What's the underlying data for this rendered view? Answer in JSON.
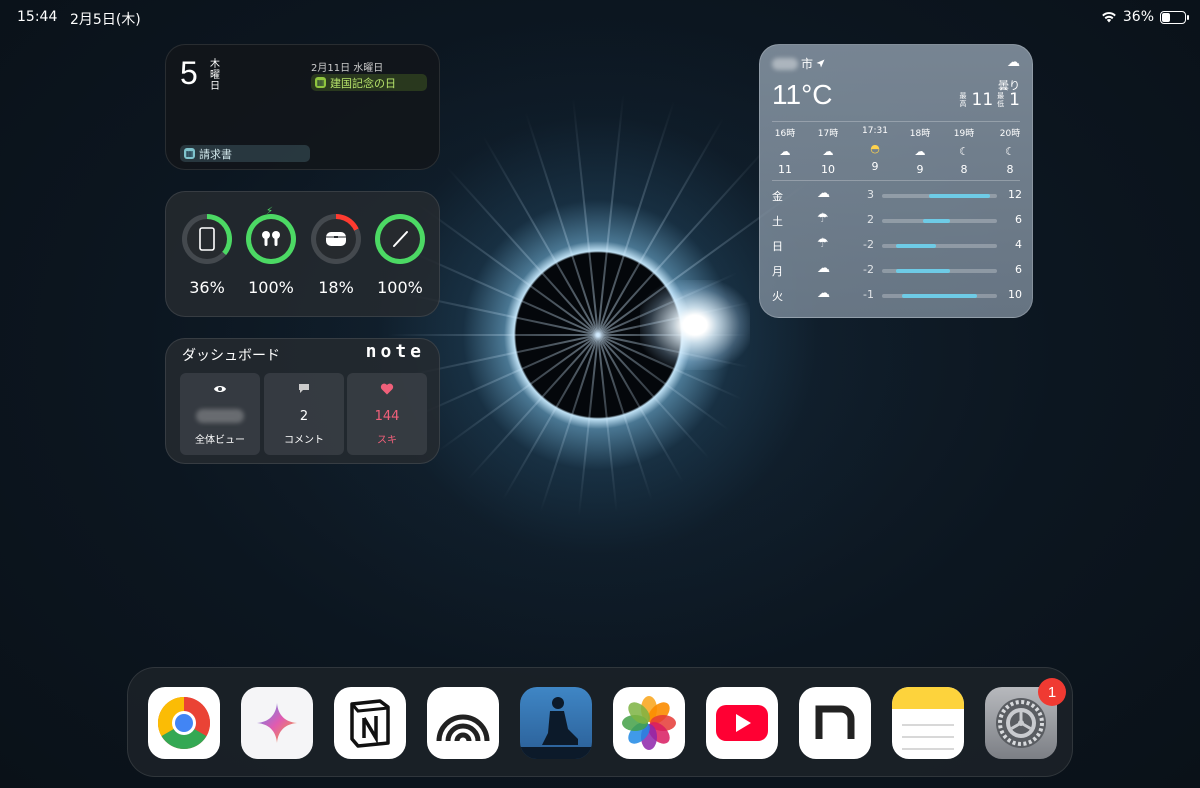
{
  "status_bar": {
    "time": "15:44",
    "date": "2月5日(木)",
    "battery_text": "36%",
    "battery_level": 0.36
  },
  "calendar": {
    "day": "5",
    "weekday": "木曜日",
    "today_event": "請求書",
    "upcoming_date": "2月11日 水曜日",
    "upcoming_event": "建国記念の日"
  },
  "batteries": [
    {
      "device": "ipad",
      "icon": "tablet-icon",
      "level": 0.36,
      "text": "36%",
      "color": "#4cd964"
    },
    {
      "device": "airpods",
      "icon": "airpods-icon",
      "level": 1.0,
      "text": "100%",
      "color": "#4cd964",
      "charging": true
    },
    {
      "device": "airpods-case",
      "icon": "airpods-case-icon",
      "level": 0.18,
      "text": "18%",
      "color": "#ff3b30"
    },
    {
      "device": "pencil",
      "icon": "pencil-icon",
      "level": 1.0,
      "text": "100%",
      "color": "#4cd964"
    }
  ],
  "dashboard": {
    "title": "ダッシュボード",
    "logo": "note",
    "tiles": [
      {
        "icon": "eye-icon",
        "value": "",
        "label": "全体ビュー"
      },
      {
        "icon": "comment-icon",
        "value": "2",
        "label": "コメント"
      },
      {
        "icon": "heart-icon",
        "value": "144",
        "label": "スキ"
      }
    ]
  },
  "weather": {
    "city_suffix": "市",
    "temperature": "11°C",
    "condition": "曇り",
    "hi_label": "最高",
    "hi": "11",
    "lo_label": "最低",
    "lo": "1",
    "hourly": [
      {
        "time": "16時",
        "icon": "cloud-icon",
        "temp": "11"
      },
      {
        "time": "17時",
        "icon": "cloud-icon",
        "temp": "10"
      },
      {
        "time": "17:31",
        "icon": "sunset-icon",
        "temp": "9"
      },
      {
        "time": "18時",
        "icon": "partly-cloudy-night-icon",
        "temp": "9"
      },
      {
        "time": "19時",
        "icon": "moon-icon",
        "temp": "8"
      },
      {
        "time": "20時",
        "icon": "moon-icon",
        "temp": "8"
      }
    ],
    "daily": [
      {
        "day": "金",
        "icon": "cloud-icon",
        "low": "3",
        "high": "12",
        "low_val": 3,
        "high_val": 12
      },
      {
        "day": "土",
        "icon": "cloud-rain-icon",
        "low": "2",
        "high": "6",
        "low_val": 2,
        "high_val": 6
      },
      {
        "day": "日",
        "icon": "cloud-rain-icon",
        "low": "-2",
        "high": "4",
        "low_val": -2,
        "high_val": 4
      },
      {
        "day": "月",
        "icon": "cloud-icon",
        "low": "-2",
        "high": "6",
        "low_val": -2,
        "high_val": 6
      },
      {
        "day": "火",
        "icon": "cloud-icon",
        "low": "-1",
        "high": "10",
        "low_val": -1,
        "high_val": 10
      }
    ],
    "range": [
      -4,
      13
    ]
  },
  "dock": {
    "apps": [
      "chrome",
      "gemini",
      "notion",
      "arc",
      "kindle",
      "photos",
      "youtube",
      "note",
      "notes",
      "settings"
    ],
    "settings_badge": "1"
  }
}
